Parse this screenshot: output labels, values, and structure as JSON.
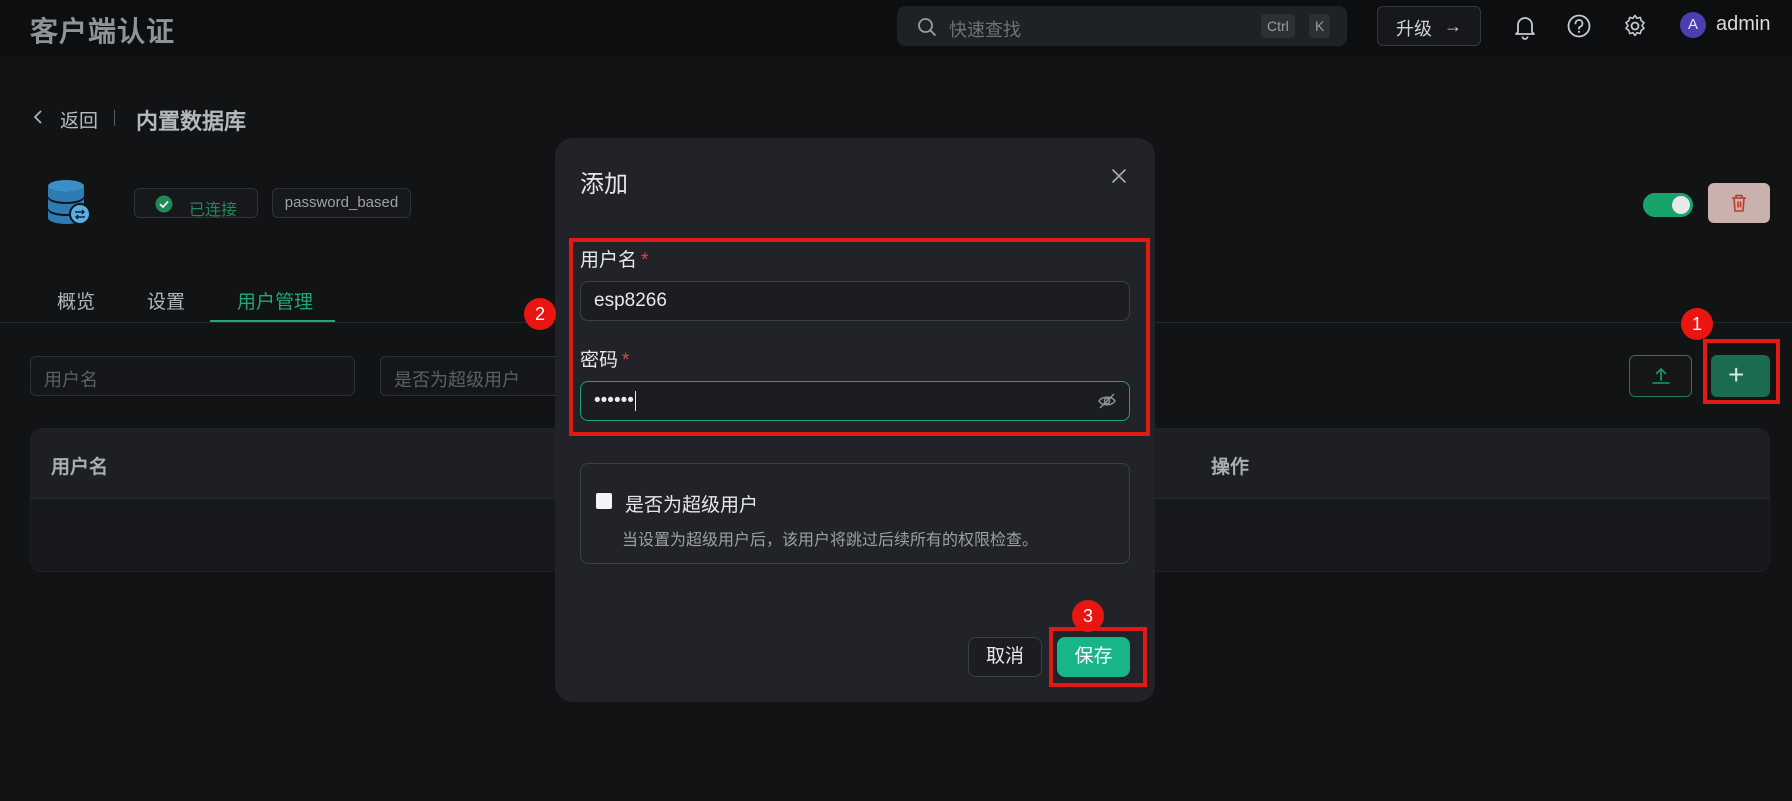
{
  "app": {
    "title": "客户端认证"
  },
  "topbar": {
    "search_placeholder": "快速查找",
    "shortcut_keys": [
      "Ctrl",
      "K"
    ],
    "upgrade_label": "升级",
    "upgrade_arrow": "→",
    "icons": [
      "bell-icon",
      "help-icon",
      "settings-icon"
    ],
    "avatar_letter": "A",
    "username": "admin"
  },
  "page": {
    "back_label": "返回",
    "title": "内置数据库",
    "status_label": "已连接",
    "auth_type": "password_based",
    "enabled": true
  },
  "tabs": [
    {
      "label": "概览",
      "active": false
    },
    {
      "label": "设置",
      "active": false
    },
    {
      "label": "用户管理",
      "active": true
    }
  ],
  "filters": {
    "username_placeholder": "用户名",
    "superuser_placeholder": "是否为超级用户"
  },
  "table": {
    "columns": [
      "用户名",
      "操作"
    ],
    "rows": []
  },
  "modal": {
    "title": "添加",
    "username_label": "用户名",
    "username_value": "esp8266",
    "password_label": "密码",
    "password_value": "••••••",
    "required_mark": "*",
    "superuser_label": "是否为超级用户",
    "superuser_help": "当设置为超级用户后，该用户将跳过后续所有的权限检查。",
    "superuser_checked": false,
    "cancel_label": "取消",
    "save_label": "保存"
  },
  "annotations": {
    "markers": [
      "1",
      "2",
      "3"
    ],
    "box_color": "#e01a14"
  },
  "colors": {
    "accent": "#18b588",
    "status_green": "#1f8a55",
    "danger_bg": "#c9b1ad"
  }
}
